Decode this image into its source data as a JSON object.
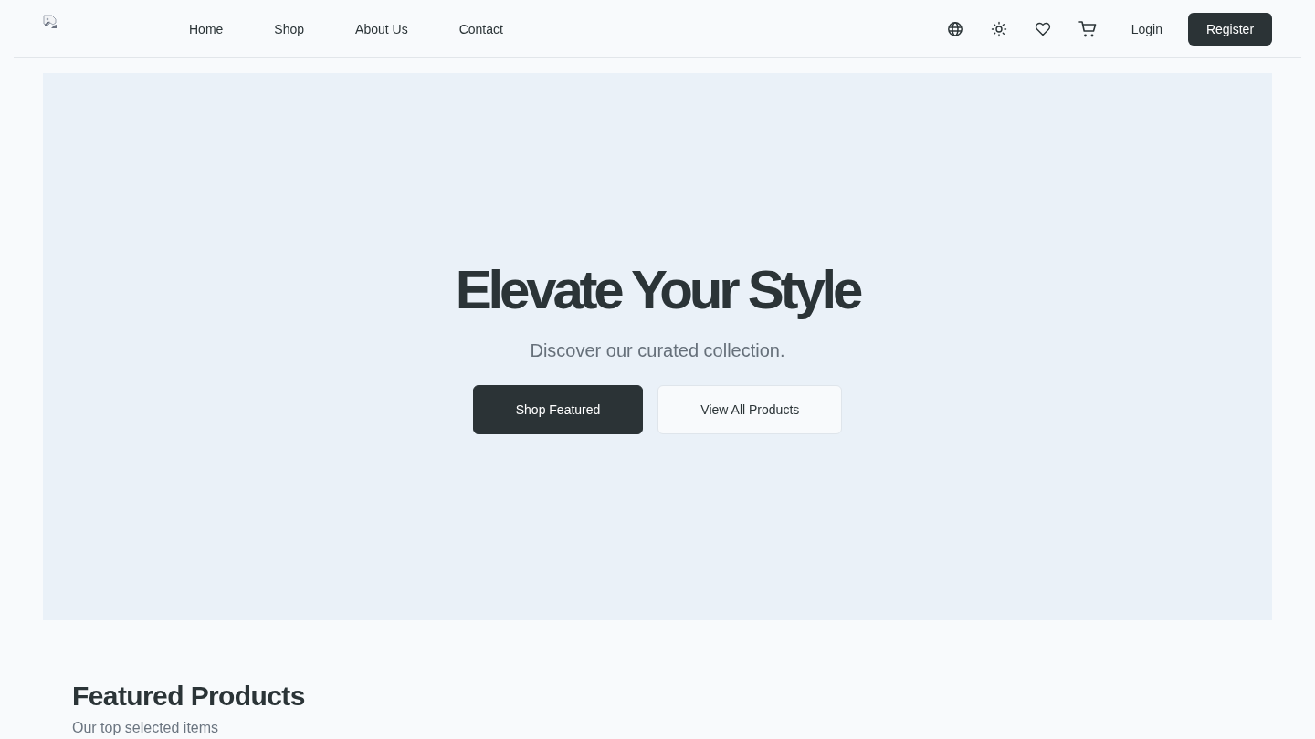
{
  "header": {
    "nav": [
      {
        "label": "Home"
      },
      {
        "label": "Shop"
      },
      {
        "label": "About Us"
      },
      {
        "label": "Contact"
      }
    ],
    "login": "Login",
    "register": "Register"
  },
  "hero": {
    "title": "Elevate Your Style",
    "subtitle": "Discover our curated collection.",
    "buttons": [
      {
        "label": "Shop Featured",
        "kind": "primary"
      },
      {
        "label": "View All Products",
        "kind": "secondary"
      }
    ]
  },
  "featured": {
    "title": "Featured Products",
    "subtitle": "Our top selected items"
  }
}
